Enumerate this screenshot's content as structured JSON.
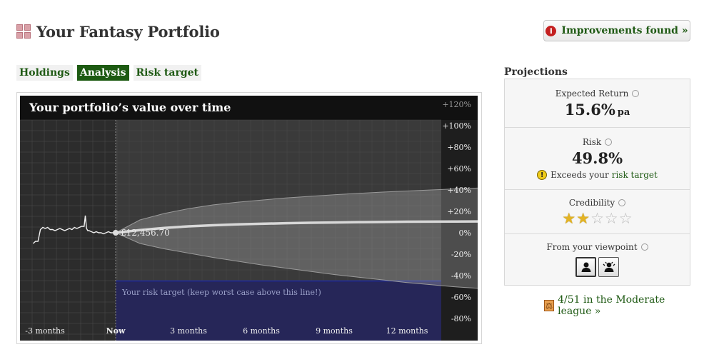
{
  "header": {
    "title": "Your Fantasy Portfolio",
    "logo_icon": "grid-logo-icon"
  },
  "improvements_button": {
    "label": "Improvements found »",
    "icon": "info-icon",
    "icon_glyph": "i"
  },
  "tabs": [
    {
      "label": "Holdings",
      "active": false
    },
    {
      "label": "Analysis",
      "active": true
    },
    {
      "label": "Risk target",
      "active": false
    }
  ],
  "chart_data": {
    "type": "line",
    "title": "Your portfolio’s value over time",
    "x_ticks": [
      "-3 months",
      "Now",
      "3 months",
      "6 months",
      "9 months",
      "12 months"
    ],
    "y_ticks": [
      "+120%",
      "+100%",
      "+80%",
      "+60%",
      "+40%",
      "+20%",
      "0%",
      "-20%",
      "-40%",
      "-60%",
      "-80%"
    ],
    "ylim": [
      -85,
      122
    ],
    "xlim": [
      -3.4,
      16.6
    ],
    "grid": true,
    "current_value_label": "£12,456.70",
    "risk_target_label": "Your risk target (keep worst case above this line!)",
    "risk_target_pct": -45,
    "history": {
      "name": "history",
      "x": [
        -3.4,
        -3.3,
        -3.2,
        -3.1,
        -3.0,
        -2.9,
        -2.8,
        -2.7,
        -2.6,
        -2.5,
        -2.4,
        -2.3,
        -2.2,
        -2.1,
        -2.0,
        -1.9,
        -1.8,
        -1.7,
        -1.6,
        -1.5,
        -1.4,
        -1.3,
        -1.25,
        -1.2,
        -1.15,
        -1.1,
        -1.0,
        -0.9,
        -0.8,
        -0.7,
        -0.6,
        -0.5,
        -0.4,
        -0.3,
        -0.2,
        -0.1,
        0
      ],
      "y": [
        -10,
        -8,
        -8,
        3,
        5,
        4,
        5,
        3,
        3,
        2,
        3,
        4,
        3,
        2,
        3,
        4,
        3,
        5,
        4,
        5,
        6,
        6,
        16,
        4,
        2,
        2,
        1,
        0,
        1,
        0,
        0,
        -1,
        0,
        1,
        0,
        0,
        0
      ]
    },
    "projection": {
      "name": "projection",
      "months": [
        0,
        1,
        2,
        3,
        4,
        5,
        6,
        7,
        8,
        9,
        10,
        11,
        12,
        13,
        14,
        15,
        16.6
      ],
      "expected": [
        0,
        2.5,
        4.5,
        6,
        7,
        7.8,
        8.4,
        8.9,
        9.3,
        9.6,
        9.9,
        10.1,
        10.3,
        10.4,
        10.5,
        10.6,
        10.7
      ],
      "upper": [
        0,
        12,
        18,
        22.5,
        26,
        28.5,
        30.5,
        32.5,
        34,
        35.5,
        36.8,
        38,
        39,
        40,
        41,
        41.8,
        43
      ],
      "lower": [
        0,
        -10,
        -15,
        -19,
        -23,
        -26.5,
        -30,
        -33,
        -36,
        -39,
        -41.5,
        -44,
        -46.5,
        -48.5,
        -50.5,
        -52,
        -55
      ]
    }
  },
  "projections": {
    "heading": "Projections",
    "expected_return": {
      "label": "Expected Return",
      "value": "15.6%",
      "unit": "pa"
    },
    "risk": {
      "label": "Risk",
      "value": "49.8%",
      "warning_prefix": "Exceeds your",
      "warning_link": "risk target",
      "warning_icon_glyph": "!"
    },
    "credibility": {
      "label": "Credibility",
      "stars_filled": 2,
      "stars_total": 5
    },
    "viewpoint": {
      "label": "From your viewpoint",
      "options": [
        "person-icon",
        "advisor-icon"
      ],
      "selected": 0
    }
  },
  "league": {
    "label": "4/51 in the Moderate league »",
    "icon": "scales-icon",
    "icon_glyph": "⚖"
  },
  "colors": {
    "accent_green": "#1d5a12",
    "link_green": "#1f5a14",
    "chart_bg": "#303030",
    "risk_zone": "#25255a",
    "star": "#e3b324"
  }
}
